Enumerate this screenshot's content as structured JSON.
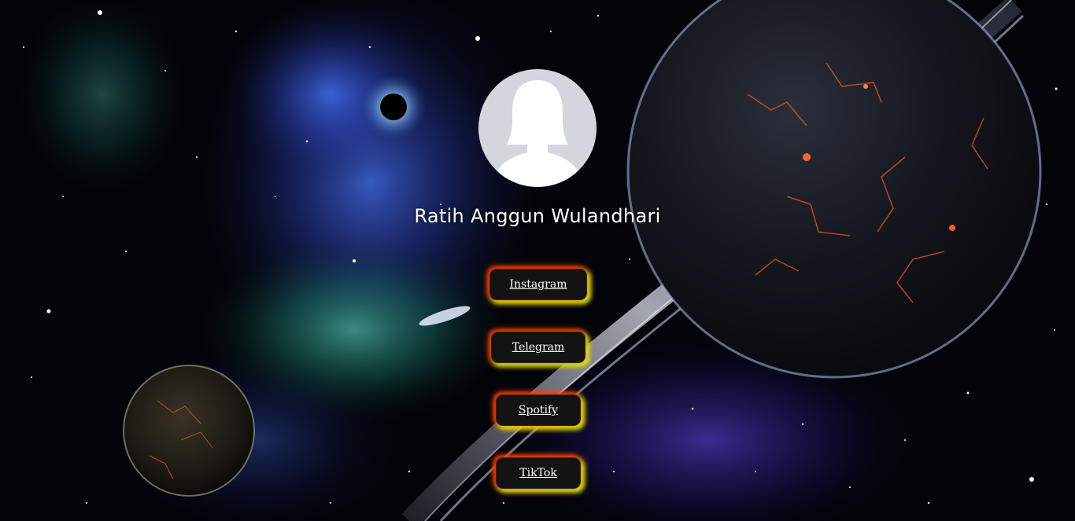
{
  "profile": {
    "name": "Ratih Anggun Wulandhari"
  },
  "links": {
    "instagram": "Instagram",
    "telegram": "Telegram",
    "spotify": "Spotify",
    "tiktok": "TikTok"
  },
  "icons": {
    "avatar": "default-female-avatar-icon"
  },
  "colors": {
    "button_bg": "#141313",
    "glow_red": "#ff2800",
    "glow_yellow": "#e1eb14",
    "avatar_bg": "#d3d6dc"
  }
}
